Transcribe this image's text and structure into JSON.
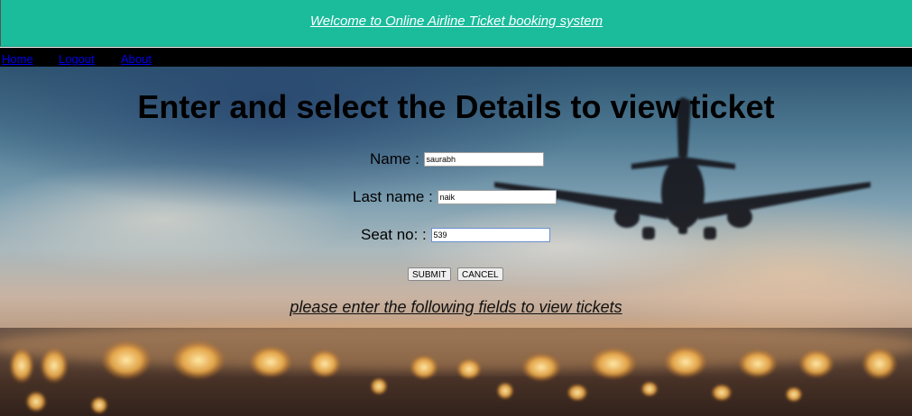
{
  "header": {
    "title": "Welcome to Online Airline Ticket booking system",
    "color": "#1abc9c"
  },
  "nav": {
    "home": "Home",
    "logout": "Logout",
    "about": "About"
  },
  "form": {
    "heading": "Enter and select the Details to view ticket",
    "name": {
      "label": "Name :",
      "value": "saurabh"
    },
    "last_name": {
      "label": "Last name :",
      "value": "naik"
    },
    "seat": {
      "label": "Seat no: :",
      "value": "539"
    },
    "submit_label": "SUBMIT",
    "cancel_label": "CANCEL",
    "hint": "please enter the following fields to view tickets"
  },
  "background_image": "airplane-takeoff-bokeh"
}
